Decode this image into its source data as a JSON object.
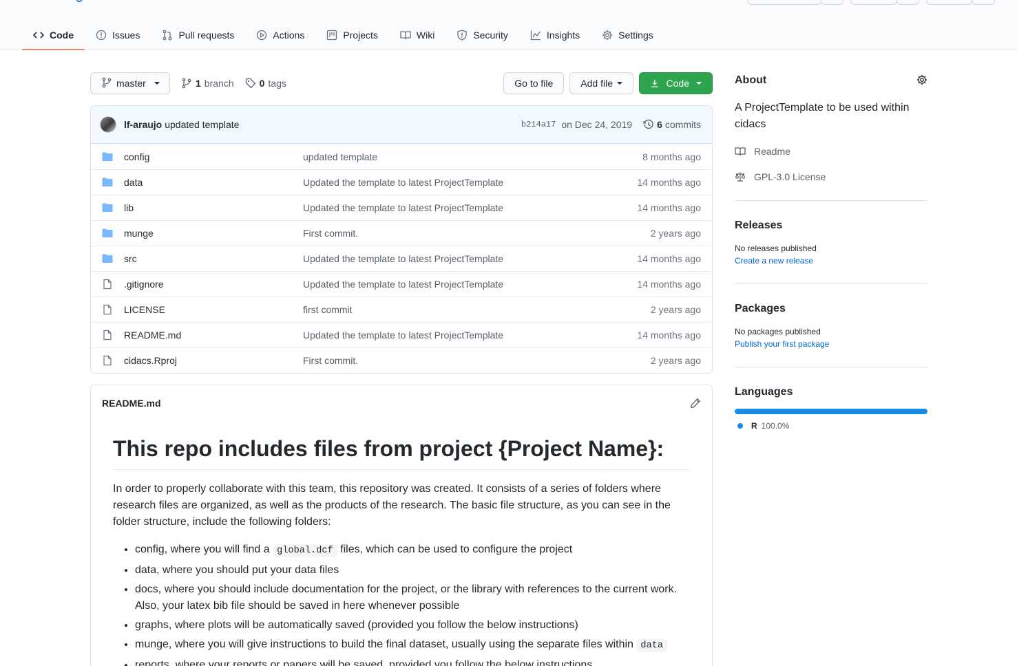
{
  "nav": {
    "tabs": [
      {
        "label": "Code",
        "icon": "code-icon"
      },
      {
        "label": "Issues",
        "icon": "issue-icon"
      },
      {
        "label": "Pull requests",
        "icon": "pull-request-icon"
      },
      {
        "label": "Actions",
        "icon": "play-icon"
      },
      {
        "label": "Projects",
        "icon": "project-icon"
      },
      {
        "label": "Wiki",
        "icon": "book-icon"
      },
      {
        "label": "Security",
        "icon": "shield-icon"
      },
      {
        "label": "Insights",
        "icon": "graph-icon"
      },
      {
        "label": "Settings",
        "icon": "gear-icon"
      }
    ],
    "active_tab": "Code"
  },
  "toolbar": {
    "branch": "master",
    "branch_count": "1",
    "branch_label": "branch",
    "tag_count": "0",
    "tag_label": "tags",
    "go_to_file": "Go to file",
    "add_file": "Add file",
    "code": "Code"
  },
  "commit": {
    "author": "lf-araujo",
    "message": "updated template",
    "sha": "b214a17",
    "date": "on Dec 24, 2019",
    "count": "6",
    "count_label": "commits"
  },
  "files": [
    {
      "type": "dir",
      "name": "config",
      "message": "updated template",
      "age": "8 months ago"
    },
    {
      "type": "dir",
      "name": "data",
      "message": "Updated the template to latest ProjectTemplate",
      "age": "14 months ago"
    },
    {
      "type": "dir",
      "name": "lib",
      "message": "Updated the template to latest ProjectTemplate",
      "age": "14 months ago"
    },
    {
      "type": "dir",
      "name": "munge",
      "message": "First commit.",
      "age": "2 years ago"
    },
    {
      "type": "dir",
      "name": "src",
      "message": "Updated the template to latest ProjectTemplate",
      "age": "14 months ago"
    },
    {
      "type": "file",
      "name": ".gitignore",
      "message": "Updated the template to latest ProjectTemplate",
      "age": "14 months ago"
    },
    {
      "type": "file",
      "name": "LICENSE",
      "message": "first commit",
      "age": "2 years ago"
    },
    {
      "type": "file",
      "name": "README.md",
      "message": "Updated the template to latest ProjectTemplate",
      "age": "14 months ago"
    },
    {
      "type": "file",
      "name": "cidacs.Rproj",
      "message": "First commit.",
      "age": "2 years ago"
    }
  ],
  "readme": {
    "filename": "README.md",
    "heading": "This repo includes files from project {Project Name}:",
    "intro": "In order to properly collaborate with this team, this repository was created. It consists of a series of folders where research files are organized, as well as the products of the research. The basic file structure, as you can see in the folder structure, include the following folders:",
    "items": {
      "config_pre": "config, where you will find a",
      "config_code": "global.dcf",
      "config_post": "files, which can be used to configure the project",
      "data": "data, where you should put your data files",
      "docs": "docs, where you should include documentation for the project, or the library with references to the current work. Also, your latex bib file should be saved in here whenever possible",
      "graphs": "graphs, where plots will be automatically saved (provided you follow the below instructions)",
      "munge_pre": "munge, where you will give instructions to build the final dataset, usually using the separate files within",
      "munge_code": "data",
      "reports": "reports, where your reports or papers will be saved, provided you follow the below instructions"
    }
  },
  "sidebar": {
    "about_title": "About",
    "description": "A ProjectTemplate to be used within cidacs",
    "readme_link": "Readme",
    "license_link": "GPL-3.0 License",
    "releases_title": "Releases",
    "releases_text": "No releases published",
    "releases_link": "Create a new release",
    "packages_title": "Packages",
    "packages_text": "No packages published",
    "packages_link": "Publish your first package",
    "languages_title": "Languages",
    "language_name": "R",
    "language_percent": "100.0%",
    "language_share": 100,
    "language_color": "#198CE7"
  },
  "colors": {
    "accent_blue": "#0366d6",
    "green_button": "#2ea44f",
    "active_tab_underline": "#f9826c",
    "folder_blue": "#79b8ff"
  }
}
